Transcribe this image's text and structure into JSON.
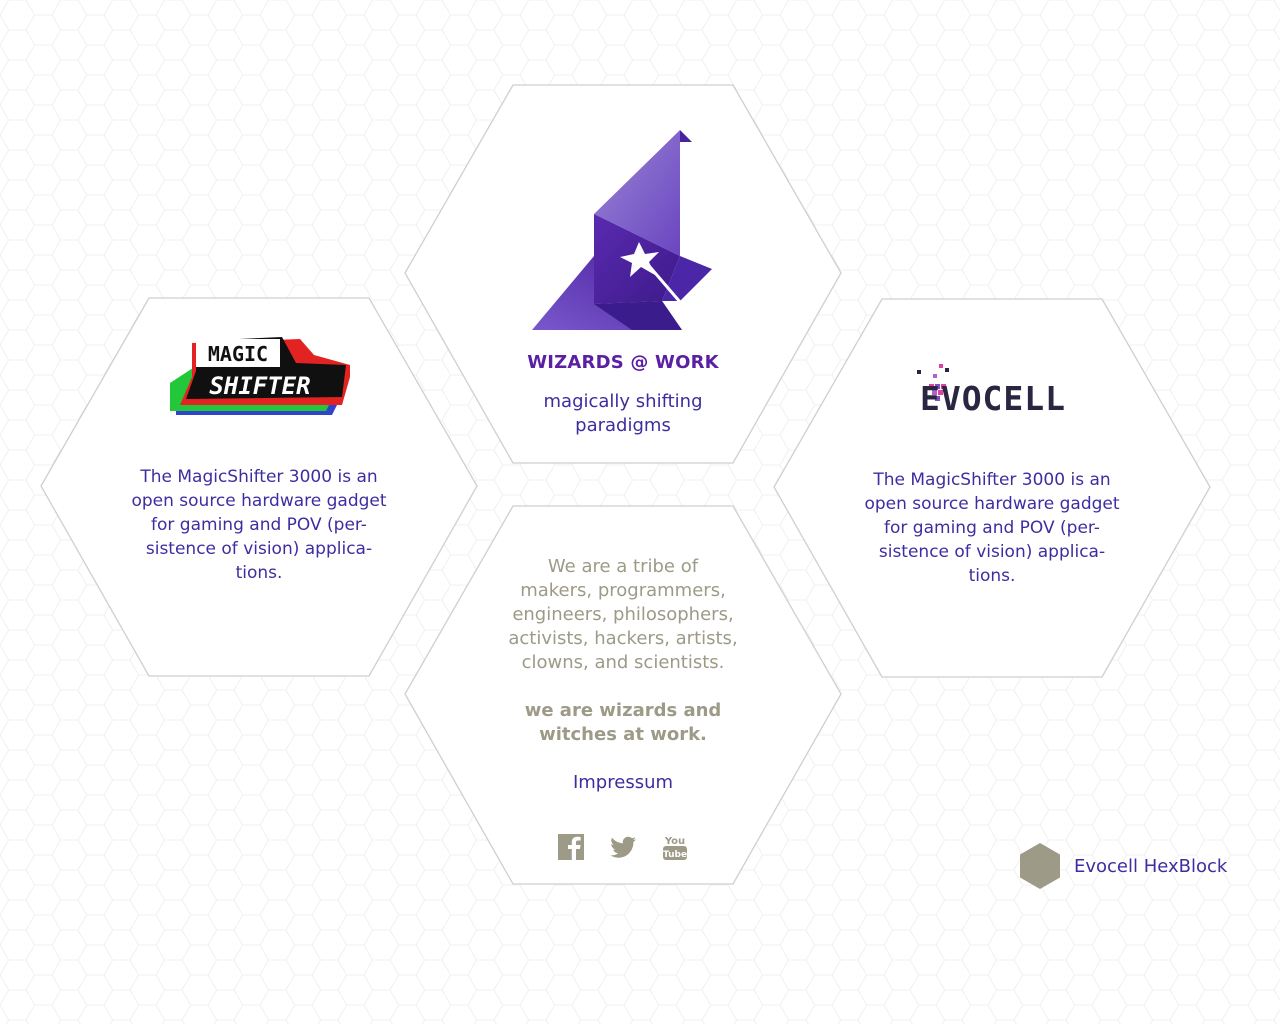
{
  "colors": {
    "accent_purple": "#5a1fa3",
    "text_indigo": "#3d2ea0",
    "muted_khaki": "#9d9a88",
    "hex_border": "#cfcfcf",
    "badge_gray": "#9d9a88"
  },
  "wizards": {
    "title": "WIZARDS @ WORK",
    "subtitle": "magically shifting\nparadigms"
  },
  "magicshifter": {
    "logo_line1": "MAGIC",
    "logo_line2": "SHIFTER",
    "description": "The MagicShifter 3000 is an\nopen source hardware gadget\nfor gaming and POV (per-\nsistence of vision) applica-\ntions."
  },
  "evocell": {
    "logo_text": "EVOCELL",
    "description": "The MagicShifter 3000 is an\nopen source hardware gadget\nfor gaming and POV (per-\nsistence of vision) applica-\ntions."
  },
  "about": {
    "text": "We are a tribe of\nmakers, programmers,\nengineers, philosophers,\nactivists, hackers, artists,\nclowns, and scientists.",
    "bold": "we are wizards and\nwitches at work.",
    "impressum": "Impressum"
  },
  "social": {
    "icons": [
      "facebook-icon",
      "twitter-icon",
      "youtube-icon"
    ],
    "youtube_line1": "You",
    "youtube_line2": "Tube"
  },
  "footer": {
    "badge_label": "Evocell HexBlock"
  }
}
